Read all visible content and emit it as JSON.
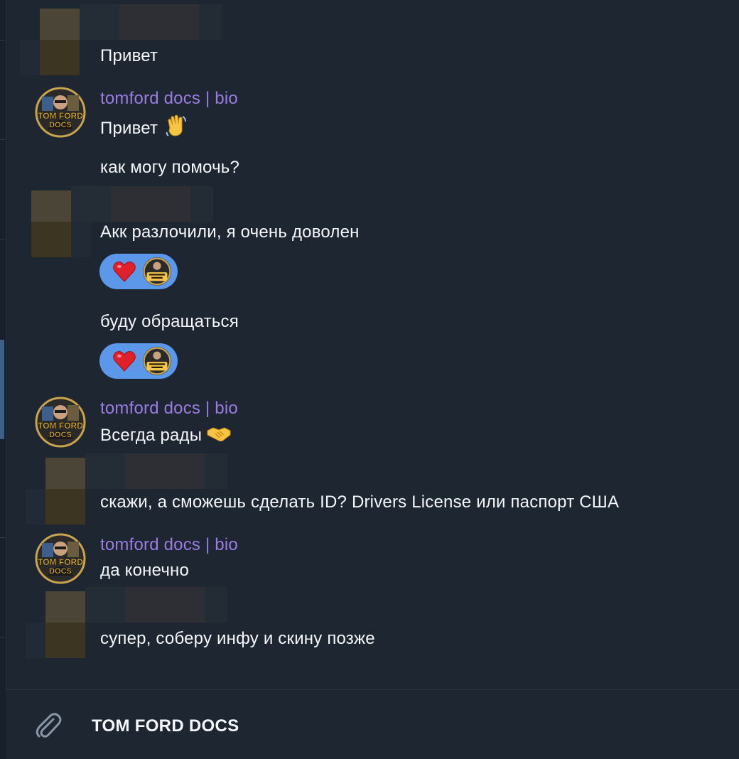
{
  "messages": [
    {
      "type": "incoming-redacted",
      "text": "Привет"
    },
    {
      "type": "outgoing",
      "sender": "tomford docs | bio",
      "lines": [
        {
          "text": "Привет",
          "emoji": "waving-hand"
        },
        {
          "text": "как могу помочь?"
        }
      ]
    },
    {
      "type": "incoming-redacted",
      "lines": [
        {
          "text": "Акк разлочили, я очень доволен",
          "reaction": "heart"
        },
        {
          "text": "буду обращаться",
          "reaction": "heart"
        }
      ]
    },
    {
      "type": "outgoing",
      "sender": "tomford docs | bio",
      "lines": [
        {
          "text": "Всегда рады",
          "emoji": "handshake"
        }
      ]
    },
    {
      "type": "incoming-redacted",
      "text": "скажи, а сможешь сделать ID? Drivers License или паспорт США"
    },
    {
      "type": "outgoing",
      "sender": "tomford docs | bio",
      "lines": [
        {
          "text": "да конечно"
        }
      ]
    },
    {
      "type": "incoming-redacted",
      "text": "супер, соберу инфу и скину позже"
    }
  ],
  "avatar_logo": {
    "line1": "TOM FORD",
    "line2": "DOCS"
  },
  "composer": {
    "text": "TOM FORD DOCS",
    "icon": "paperclip-icon"
  },
  "colors": {
    "background": "#1d2631",
    "sender_name": "#9b7ce4",
    "reaction_bubble": "#5c98ea",
    "text": "#f5f7fa"
  }
}
